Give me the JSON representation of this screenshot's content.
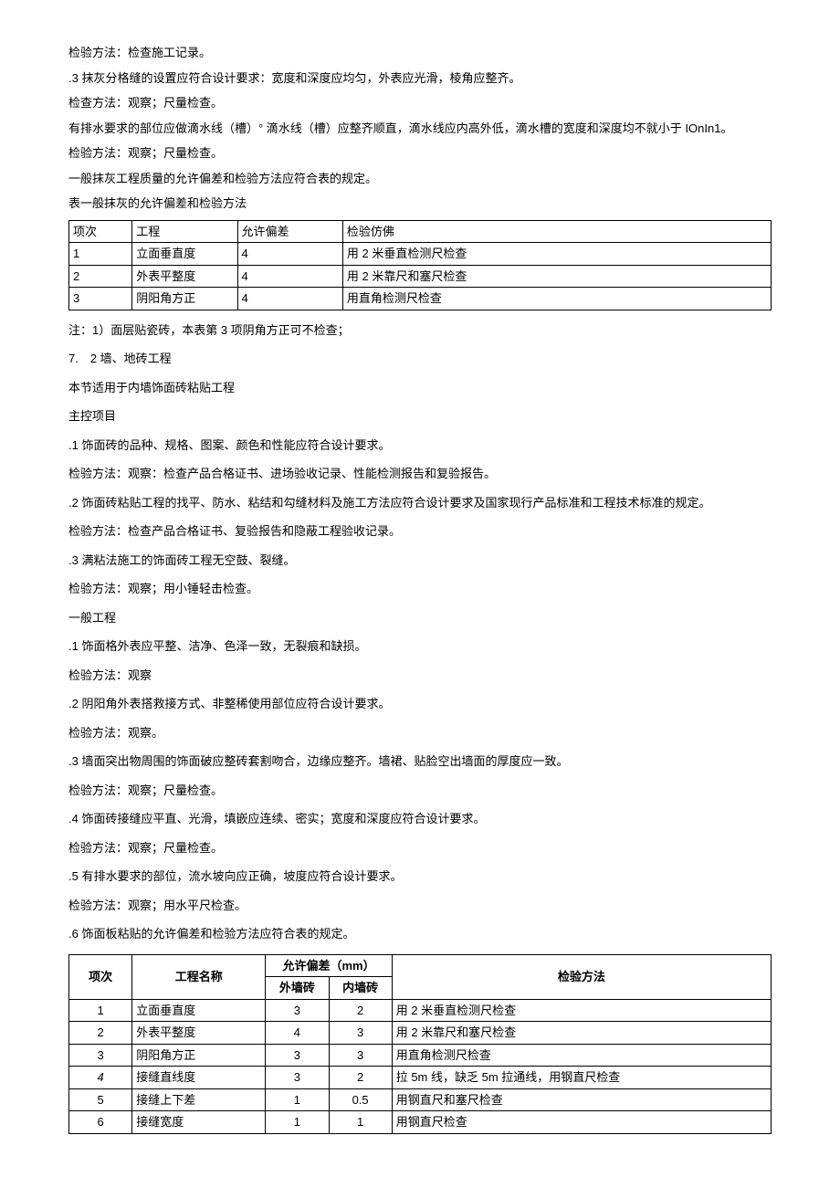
{
  "intro": {
    "p1": "检验方法：检查施工记录。",
    "p2": ".3 抹灰分格缝的设置应符合设计要求：宽度和深度应均匀，外表应光滑，棱角应整齐。",
    "p3": "检查方法：观察；尺量检查。",
    "p4": "有排水要求的部位应做滴水线（槽）° 滴水线（槽）应整齐顺直，滴水线应内高外低，滴水槽的宽度和深度均不就小于 IOnIn1。",
    "p5": "检验方法：观察；尺量检查。",
    "p6": "一般抹灰工程质量的允许偏差和检验方法应符合表的规定。",
    "p7": "表一般抹灰的允许偏差和检验方法"
  },
  "table1": {
    "header": {
      "c1": "项次",
      "c2": "工程",
      "c3": "允许偏差",
      "c4": "检验仿佛"
    },
    "rows": [
      {
        "c1": "1",
        "c2": "立面垂直度",
        "c3": "4",
        "c4": "用 2 米垂直检测尺检查"
      },
      {
        "c1": "2",
        "c2": "外表平整度",
        "c3": "4",
        "c4": "用 2 米靠尺和塞尺检查"
      },
      {
        "c1": "3",
        "c2": "阴阳角方正",
        "c3": "4",
        "c4": "用直角检测尺检查"
      }
    ]
  },
  "mid": {
    "note": "注：1）面层贴瓷砖，本表第 3 项阴角方正可不检查；",
    "h1": "7.　2 墙、地砖工程",
    "p1": "本节适用于内墙饰面砖粘贴工程",
    "h2": "主控项目",
    "p2": ".1 饰面砖的品种、规格、图案、颜色和性能应符合设计要求。",
    "p3": "检验方法：观察：检查产品合格证书、进场验收记录、性能检测报告和复验报告。",
    "p4": ".2 饰面砖粘贴工程的找平、防水、粘结和勾缝材料及施工方法应符合设计要求及国家现行产品标准和工程技术标准的规定。",
    "p5": "检验方法：检查产品合格证书、复验报告和隐蔽工程验收记录。",
    "p6": ".3 满粘法施工的饰面砖工程无空鼓、裂缝。",
    "p7": "检验方法：观察；用小锤轻击检查。",
    "h3": "一般工程",
    "p8": ".1 饰面格外表应平整、洁净、色泽一致，无裂痕和缺损。",
    "p9": "检验方法：观察",
    "p10": ".2 阴阳角外表搭救接方式、非整稀使用部位应符合设计要求。",
    "p11": "检验方法：观察。",
    "p12": ".3 墙面突出物周围的饰面破应整砖套割吻合，边缘应整齐。墙裙、贴脸空出墙面的厚度应一致。",
    "p13": "检验方法：观察；尺量检查。",
    "p14": ".4 饰面砖接缝应平直、光滑，填嵌应连续、密实；宽度和深度应符合设计要求。",
    "p15": "检验方法：观察；尺量检查。",
    "p16": ".5 有排水要求的部位，流水坡向应正确，坡度应符合设计要求。",
    "p17": "检验方法：观察；用水平尺检查。",
    "p18": ".6 饰面板粘贴的允许偏差和检验方法应符合表的规定。"
  },
  "table2": {
    "header": {
      "c1": "项次",
      "c2": "工程名称",
      "c3": "允许偏差（mm）",
      "c5": "检验方法",
      "sub1": "外墙砖",
      "sub2": "内墙砖"
    },
    "rows": [
      {
        "c1": "1",
        "c2": "立面垂直度",
        "c3": "3",
        "c4": "2",
        "c5": "用 2 米垂直检测尺检查",
        "italic": false
      },
      {
        "c1": "2",
        "c2": "外表平整度",
        "c3": "4",
        "c4": "3",
        "c5": "用 2 米靠尺和塞尺检查",
        "italic": false
      },
      {
        "c1": "3",
        "c2": "阴阳角方正",
        "c3": "3",
        "c4": "3",
        "c5": "用直角检测尺检查",
        "italic": false
      },
      {
        "c1": "4",
        "c2": "接缝直线度",
        "c3": "3",
        "c4": "2",
        "c5": "拉 5m 线，缺乏 5m 拉通线，用钢直尺检查",
        "italic": true
      },
      {
        "c1": "5",
        "c2": "接缝上下差",
        "c3": "1",
        "c4": "0.5",
        "c5": "用钢直尺和塞尺检查",
        "italic": false
      },
      {
        "c1": "6",
        "c2": "接缝宽度",
        "c3": "1",
        "c4": "1",
        "c5": "用钢直尺检查",
        "italic": false
      }
    ]
  }
}
